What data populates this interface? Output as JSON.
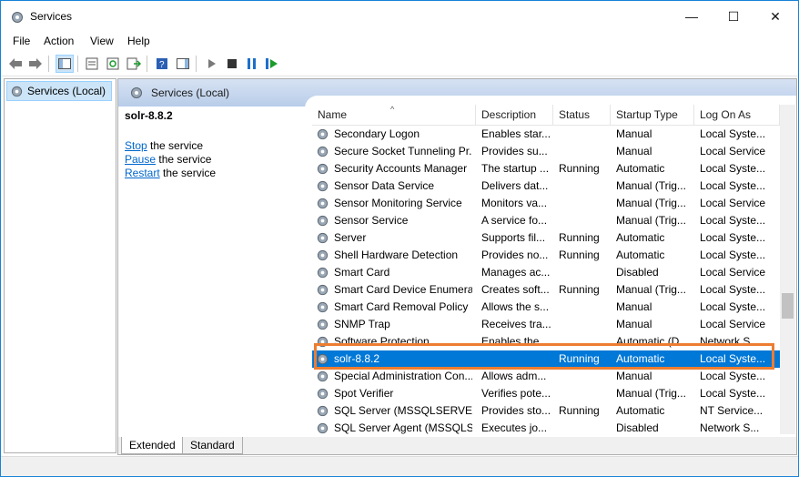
{
  "window": {
    "title": "Services"
  },
  "menu": [
    "File",
    "Action",
    "View",
    "Help"
  ],
  "tree": {
    "root": "Services (Local)"
  },
  "pane": {
    "title": "Services (Local)"
  },
  "detail": {
    "name": "solr-8.8.2",
    "actions": [
      {
        "link": "Stop",
        "rest": " the service"
      },
      {
        "link": "Pause",
        "rest": " the service"
      },
      {
        "link": "Restart",
        "rest": " the service"
      }
    ]
  },
  "columns": [
    "Name",
    "Description",
    "Status",
    "Startup Type",
    "Log On As"
  ],
  "rows": [
    [
      "Secondary Logon",
      "Enables star...",
      "",
      "Manual",
      "Local Syste..."
    ],
    [
      "Secure Socket Tunneling Pr...",
      "Provides su...",
      "",
      "Manual",
      "Local Service"
    ],
    [
      "Security Accounts Manager",
      "The startup ...",
      "Running",
      "Automatic",
      "Local Syste..."
    ],
    [
      "Sensor Data Service",
      "Delivers dat...",
      "",
      "Manual (Trig...",
      "Local Syste..."
    ],
    [
      "Sensor Monitoring Service",
      "Monitors va...",
      "",
      "Manual (Trig...",
      "Local Service"
    ],
    [
      "Sensor Service",
      "A service fo...",
      "",
      "Manual (Trig...",
      "Local Syste..."
    ],
    [
      "Server",
      "Supports fil...",
      "Running",
      "Automatic",
      "Local Syste..."
    ],
    [
      "Shell Hardware Detection",
      "Provides no...",
      "Running",
      "Automatic",
      "Local Syste..."
    ],
    [
      "Smart Card",
      "Manages ac...",
      "",
      "Disabled",
      "Local Service"
    ],
    [
      "Smart Card Device Enumera...",
      "Creates soft...",
      "Running",
      "Manual (Trig...",
      "Local Syste..."
    ],
    [
      "Smart Card Removal Policy",
      "Allows the s...",
      "",
      "Manual",
      "Local Syste..."
    ],
    [
      "SNMP Trap",
      "Receives tra...",
      "",
      "Manual",
      "Local Service"
    ],
    [
      "Software Protection",
      "Enables the ...",
      "",
      "Automatic (D...",
      "Network S..."
    ],
    [
      "solr-8.8.2",
      "",
      "Running",
      "Automatic",
      "Local Syste..."
    ],
    [
      "Special Administration Con...",
      "Allows adm...",
      "",
      "Manual",
      "Local Syste..."
    ],
    [
      "Spot Verifier",
      "Verifies pote...",
      "",
      "Manual (Trig...",
      "Local Syste..."
    ],
    [
      "SQL Server (MSSQLSERVER)",
      "Provides sto...",
      "Running",
      "Automatic",
      "NT Service..."
    ],
    [
      "SQL Server Agent (MSSQLS...",
      "Executes jo...",
      "",
      "Disabled",
      "Network S..."
    ]
  ],
  "selected_row": 13,
  "tabs": [
    "Extended",
    "Standard"
  ],
  "colors": {
    "selection": "#0078d7",
    "highlight_box": "#ed7d31",
    "link": "#0066cc"
  },
  "icons": [
    "services-gear-icon",
    "back-icon",
    "forward-icon",
    "play-icon",
    "stop-icon",
    "pause-icon",
    "restart-icon"
  ]
}
